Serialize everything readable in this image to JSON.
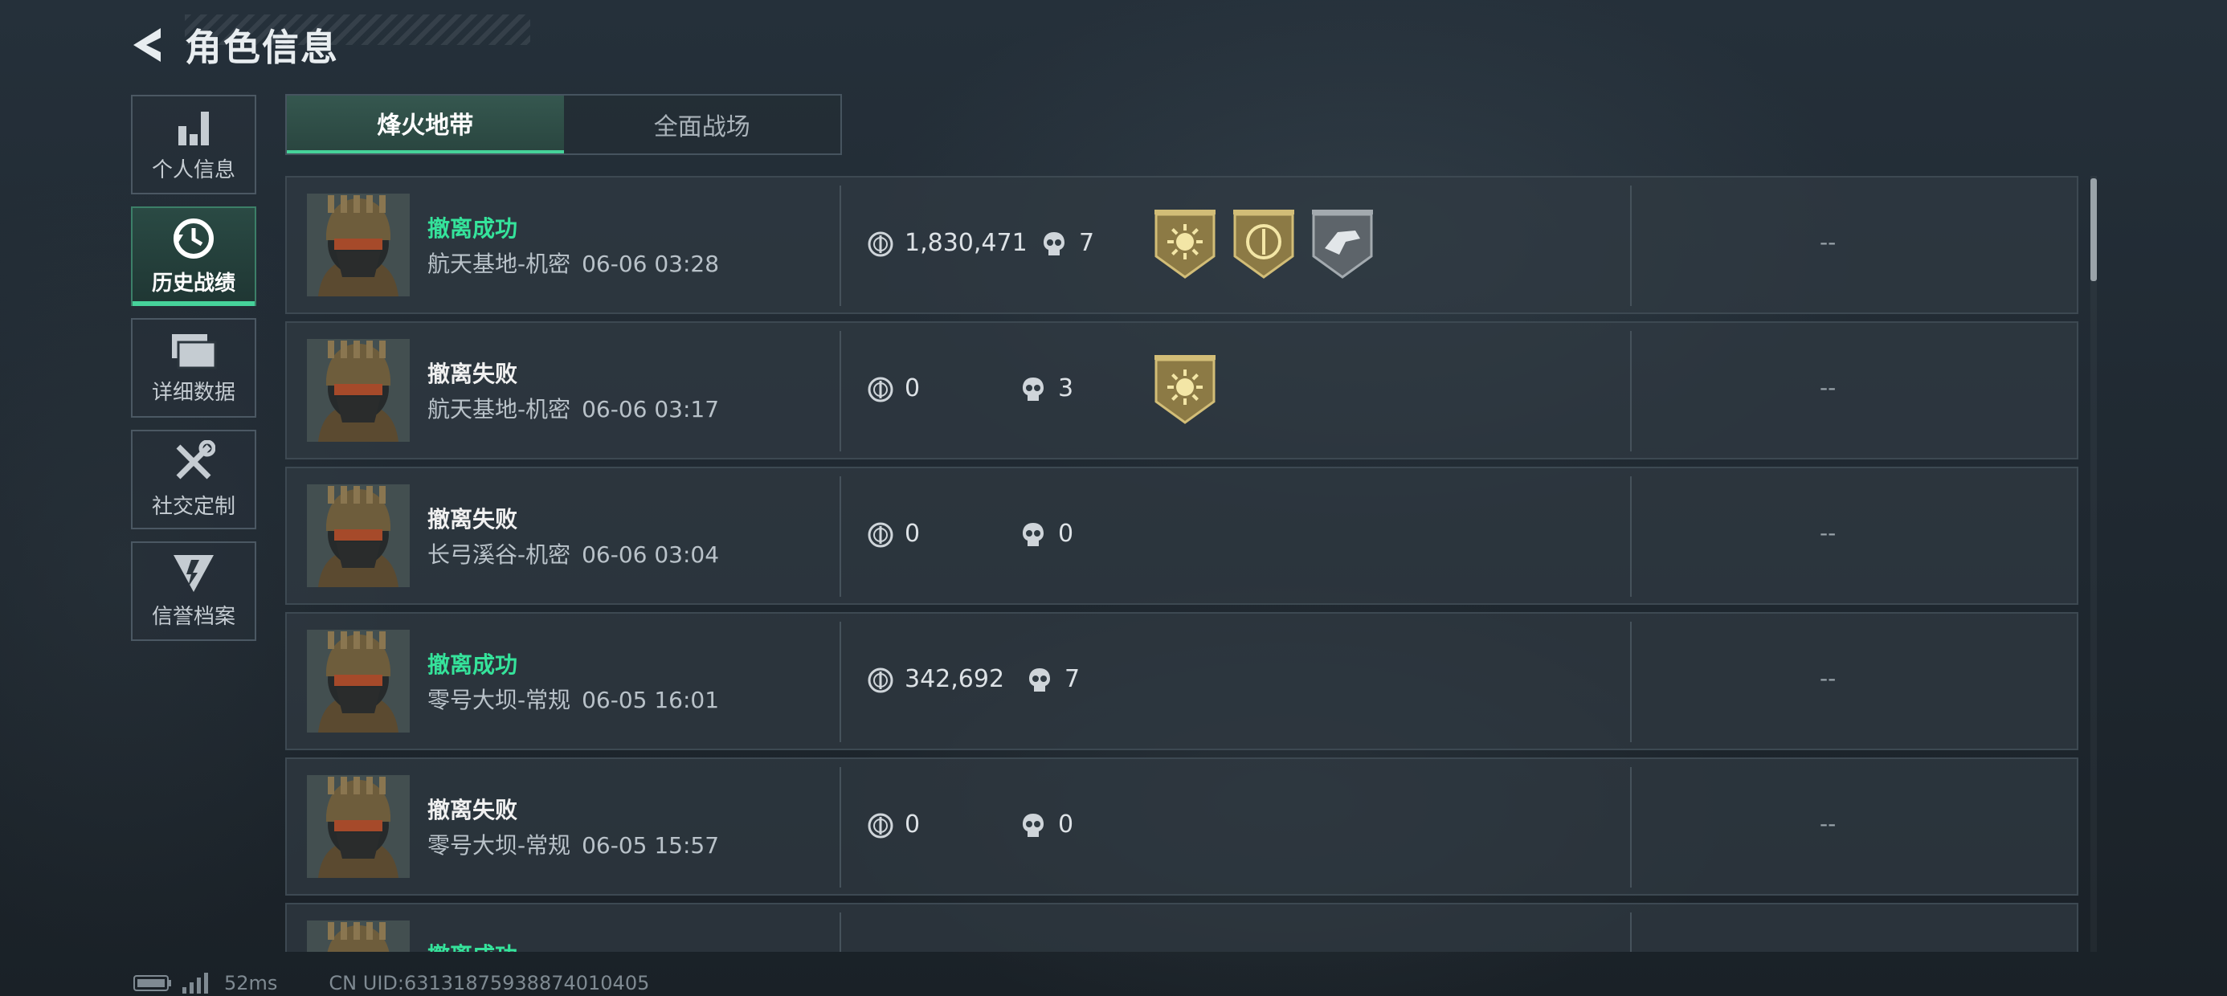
{
  "header": {
    "title": "角色信息"
  },
  "sidenav": [
    {
      "label": "个人信息"
    },
    {
      "label": "历史战绩",
      "active": true
    },
    {
      "label": "详细数据"
    },
    {
      "label": "社交定制"
    },
    {
      "label": "信誉档案"
    }
  ],
  "tabs": [
    {
      "label": "烽火地带",
      "active": true
    },
    {
      "label": "全面战场"
    }
  ],
  "matches": [
    {
      "status": "撤离成功",
      "success": true,
      "map": "航天基地-机密",
      "time": "06-06 03:28",
      "value": "1,830,471",
      "kills": "7",
      "badges": [
        "sun-medal-icon",
        "coin-medal-icon",
        "hand-medal-icon"
      ],
      "extra": "--"
    },
    {
      "status": "撤离失败",
      "success": false,
      "map": "航天基地-机密",
      "time": "06-06 03:17",
      "value": "0",
      "kills": "3",
      "badges": [
        "sun-medal-icon"
      ],
      "extra": "--"
    },
    {
      "status": "撤离失败",
      "success": false,
      "map": "长弓溪谷-机密",
      "time": "06-06 03:04",
      "value": "0",
      "kills": "0",
      "badges": [],
      "extra": "--"
    },
    {
      "status": "撤离成功",
      "success": true,
      "map": "零号大坝-常规",
      "time": "06-05 16:01",
      "value": "342,692",
      "kills": "7",
      "badges": [],
      "extra": "--"
    },
    {
      "status": "撤离失败",
      "success": false,
      "map": "零号大坝-常规",
      "time": "06-05 15:57",
      "value": "0",
      "kills": "0",
      "badges": [],
      "extra": "--"
    },
    {
      "status": "撤离成功",
      "success": true,
      "map": "",
      "time": "",
      "value": "",
      "kills": "",
      "badges": [],
      "extra": ""
    }
  ],
  "footer": {
    "ping": "52ms",
    "uid": "CN UID:631318759388740104​05"
  },
  "colors": {
    "success": "#35e39b",
    "accent": "#46d29a"
  }
}
